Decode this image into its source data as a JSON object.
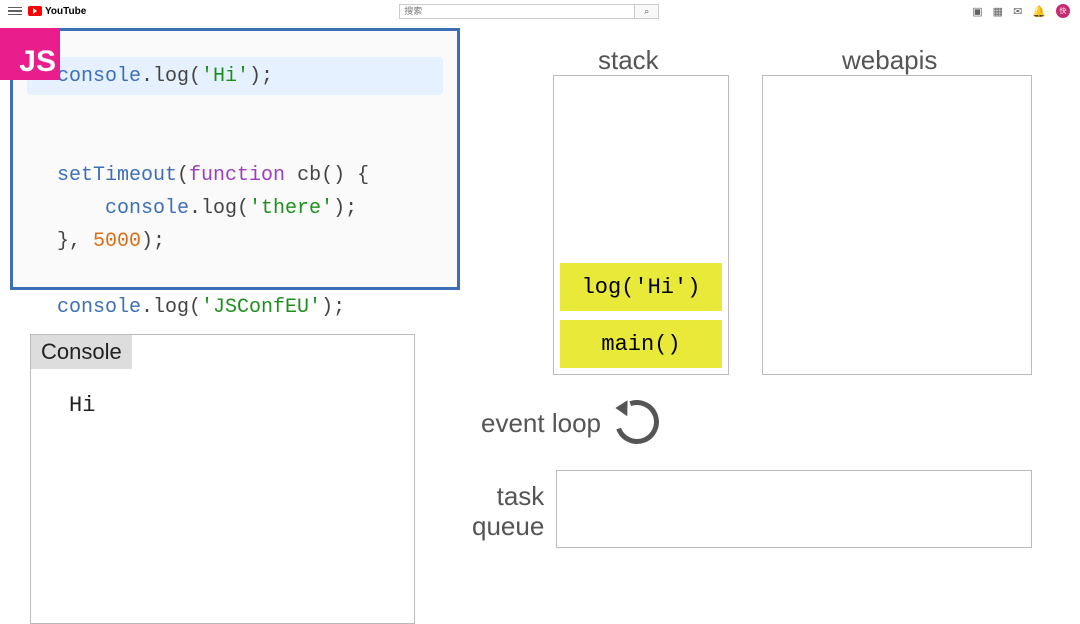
{
  "youtube": {
    "logo_text": "YouTube",
    "search_placeholder": "搜索",
    "avatar_initial": "快"
  },
  "js_badge": "JS",
  "code": {
    "l1": {
      "obj": "console",
      "rest1": ".log(",
      "str": "'Hi'",
      "rest2": ");"
    },
    "l2": {
      "fn": "setTimeout",
      "p1": "(",
      "kw": "function",
      "name": " cb() {",
      "close": ""
    },
    "l3": {
      "indent": "    ",
      "obj": "console",
      "rest1": ".log(",
      "str": "'there'",
      "rest2": ");"
    },
    "l4": {
      "close": "}, ",
      "num": "5000",
      "end": ");"
    },
    "l5": {
      "obj": "console",
      "rest1": ".log(",
      "str": "'JSConfEU'",
      "rest2": ");"
    }
  },
  "console": {
    "header": "Console",
    "lines": [
      "Hi"
    ]
  },
  "labels": {
    "stack": "stack",
    "webapis": "webapis",
    "event_loop": "event loop",
    "task_queue_1": "task",
    "task_queue_2": "queue"
  },
  "stack_frames": [
    "main()",
    "log('Hi')"
  ]
}
